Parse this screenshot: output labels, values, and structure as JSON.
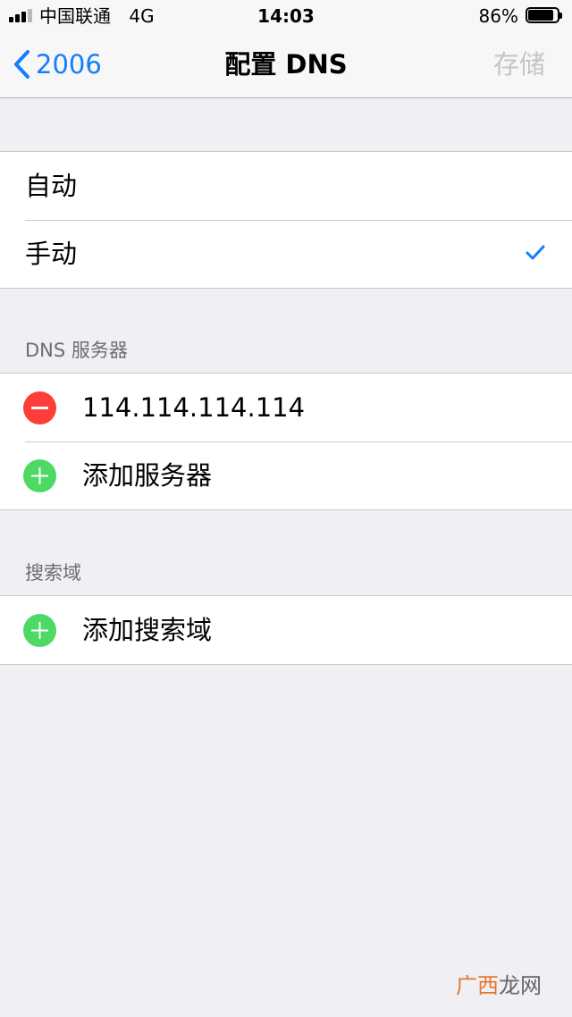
{
  "status_bar": {
    "carrier": "中国联通",
    "network": "4G",
    "time": "14:03",
    "battery_percent": "86%",
    "battery_level": 0.86,
    "signal_bars_active": 3,
    "signal_bars_total": 4
  },
  "nav": {
    "back_label": "2006",
    "title": "配置 DNS",
    "save_label": "存储"
  },
  "mode": {
    "options": [
      {
        "label": "自动",
        "selected": false
      },
      {
        "label": "手动",
        "selected": true
      }
    ]
  },
  "dns_servers": {
    "header": "DNS 服务器",
    "entries": [
      "114.114.114.114"
    ],
    "add_label": "添加服务器"
  },
  "search_domains": {
    "header": "搜索域",
    "add_label": "添加搜索域"
  },
  "watermark": {
    "accent": "广西",
    "rest": "龙网"
  },
  "colors": {
    "accent": "#147efb",
    "delete": "#fc3d39",
    "add": "#4cd964",
    "background": "#efeff4"
  },
  "icons": {
    "back": "chevron-left-icon",
    "check": "checkmark-icon",
    "delete": "minus-circle-icon",
    "add": "plus-circle-icon"
  }
}
